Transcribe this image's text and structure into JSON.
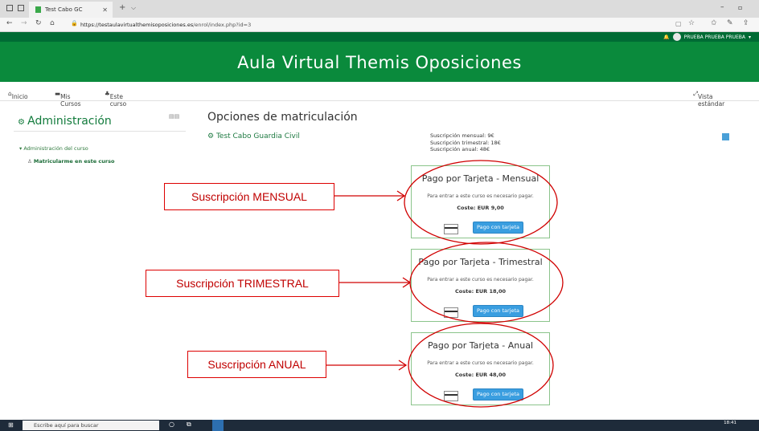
{
  "browser": {
    "tab_title": "Test Cabo GC",
    "url_domain": "https://testaulavirtualthemisoposiciones.es",
    "url_path": "/enrol/index.php?id=3"
  },
  "site": {
    "title": "Aula Virtual Themis Oposiciones",
    "user_name": "PRUEBA PRUEBA PRUEBA"
  },
  "nav": {
    "home": "Inicio",
    "my_courses": "Mis Cursos",
    "this_course": "Este curso",
    "standard_view": "Vista estándar"
  },
  "sidebar": {
    "title": "Administración",
    "course_admin": "Administración del curso",
    "enrol_me": "Matricularme en este curso"
  },
  "main": {
    "page_title": "Opciones de matriculación",
    "course_name": "Test Cabo Guardia Civil",
    "sub_monthly": "Suscripción mensual: 9€",
    "sub_quarterly": "Suscripción trimestral: 18€",
    "sub_annual": "Suscripción anual: 48€"
  },
  "cards": [
    {
      "title": "Pago por Tarjeta - Mensual",
      "desc": "Para entrar a este curso es necesario pagar.",
      "cost": "Coste: EUR 9,00",
      "button": "Pago con tarjeta"
    },
    {
      "title": "Pago por Tarjeta - Trimestral",
      "desc": "Para entrar a este curso es necesario pagar.",
      "cost": "Coste: EUR 18,00",
      "button": "Pago con tarjeta"
    },
    {
      "title": "Pago por Tarjeta - Anual",
      "desc": "Para entrar a este curso es necesario pagar.",
      "cost": "Coste: EUR 48,00",
      "button": "Pago con tarjeta"
    }
  ],
  "callouts": {
    "monthly": "Suscripción MENSUAL",
    "quarterly": "Suscripción TRIMESTRAL",
    "annual": "Suscripción ANUAL"
  },
  "taskbar": {
    "search_placeholder": "Escribe aquí para buscar",
    "time": "18:41"
  },
  "colors": {
    "brand_green": "#0a8a3c",
    "annotation_red": "#d00000",
    "pay_button_blue": "#3a9ee0"
  }
}
